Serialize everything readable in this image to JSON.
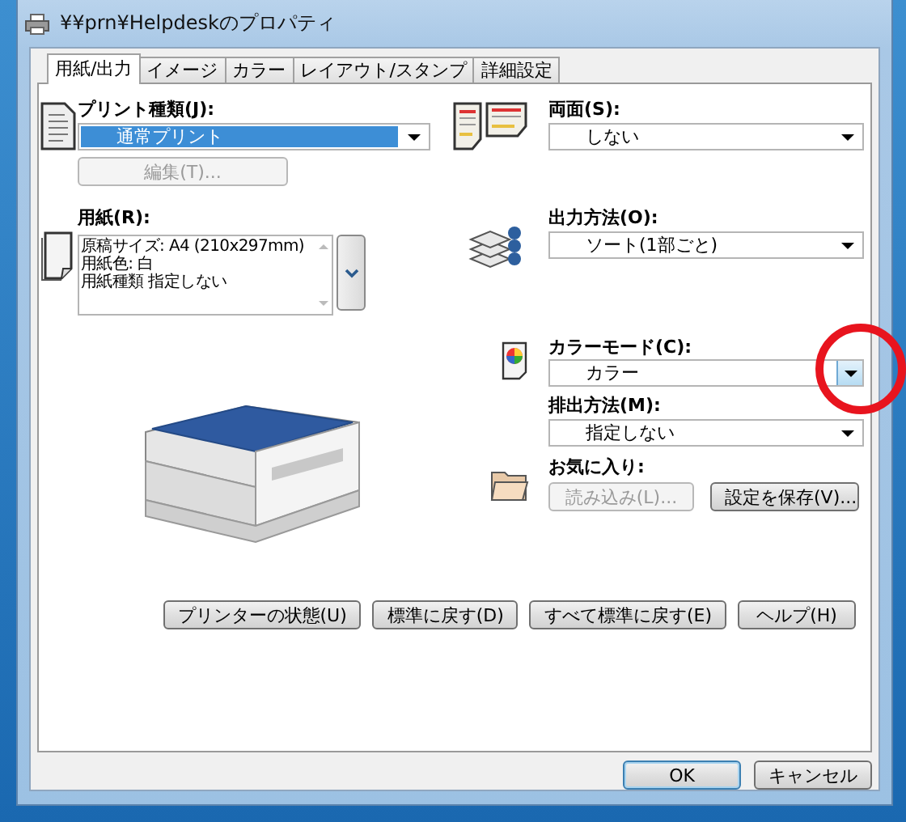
{
  "window": {
    "title": "¥¥prn¥Helpdeskのプロパティ"
  },
  "tabs": [
    {
      "label": "用紙/出力",
      "selected": true
    },
    {
      "label": "イメージ",
      "selected": false
    },
    {
      "label": "カラー",
      "selected": false
    },
    {
      "label": "レイアウト/スタンプ",
      "selected": false
    },
    {
      "label": "詳細設定",
      "selected": false
    }
  ],
  "print_type": {
    "label": "プリント種類(J):",
    "value": "通常プリント",
    "focused": true,
    "edit_button": {
      "label": "編集(T)...",
      "disabled": true
    }
  },
  "paper": {
    "label": "用紙(R):",
    "lines": [
      "原稿サイズ: A4 (210x297mm)",
      "用紙色: 白",
      "用紙種類 指定しない"
    ]
  },
  "duplex": {
    "label": "両面(S):",
    "value": "しない"
  },
  "output": {
    "label": "出力方法(O):",
    "value": "ソート(1部ごと)"
  },
  "color_mode": {
    "label": "カラーモード(C):",
    "value": "カラー",
    "circled": true
  },
  "delivery": {
    "label": "排出方法(M):",
    "value": "指定しない"
  },
  "favorites": {
    "label": "お気に入り:",
    "buttons": [
      {
        "label": "読み込み(L)...",
        "disabled": true
      },
      {
        "label": "設定を保存(V)...",
        "disabled": false
      }
    ]
  },
  "actions": [
    {
      "label": "プリンターの状態(U)"
    },
    {
      "label": "標準に戻す(D)"
    },
    {
      "label": "すべて標準に戻す(E)"
    },
    {
      "label": "ヘルプ(H)"
    }
  ],
  "dialog_buttons": [
    {
      "label": "OK",
      "default": true
    },
    {
      "label": "キャンセル",
      "default": false
    }
  ]
}
